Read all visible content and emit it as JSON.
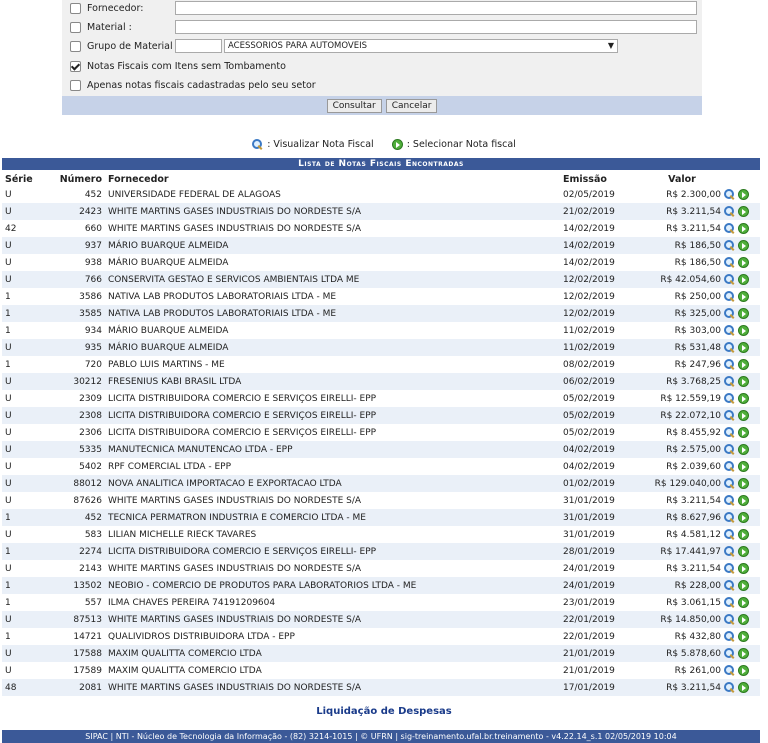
{
  "filters": {
    "fornecedor_label": "Fornecedor:",
    "material_label": "Material :",
    "grupo_label": "Grupo de Material :",
    "grupo_code": "",
    "grupo_value": "ACESSORIOS PARA AUTOMOVEIS",
    "tombamento_label": "Notas Fiscais com Itens sem Tombamento",
    "setor_label": "Apenas notas fiscais cadastradas pelo seu setor",
    "consultar": "Consultar",
    "cancelar": "Cancelar"
  },
  "legend": {
    "view": ": Visualizar Nota Fiscal",
    "select": ": Selecionar Nota fiscal"
  },
  "table": {
    "caption": "Lista de Notas Fiscais Encontradas",
    "headers": [
      "Série",
      "Número",
      "Fornecedor",
      "Emissão",
      "Valor"
    ],
    "rows": [
      [
        "U",
        "452",
        "UNIVERSIDADE FEDERAL DE ALAGOAS",
        "02/05/2019",
        "R$ 2.300,00"
      ],
      [
        "U",
        "2423",
        "WHITE MARTINS GASES INDUSTRIAIS DO NORDESTE S/A",
        "21/02/2019",
        "R$ 3.211,54"
      ],
      [
        "42",
        "660",
        "WHITE MARTINS GASES INDUSTRIAIS DO NORDESTE S/A",
        "14/02/2019",
        "R$ 3.211,54"
      ],
      [
        "U",
        "937",
        "MÁRIO BUARQUE ALMEIDA",
        "14/02/2019",
        "R$ 186,50"
      ],
      [
        "U",
        "938",
        "MÁRIO BUARQUE ALMEIDA",
        "14/02/2019",
        "R$ 186,50"
      ],
      [
        "U",
        "766",
        "CONSERVITA GESTAO E SERVICOS AMBIENTAIS LTDA ME",
        "12/02/2019",
        "R$ 42.054,60"
      ],
      [
        "1",
        "3586",
        "NATIVA LAB PRODUTOS LABORATORIAIS LTDA - ME",
        "12/02/2019",
        "R$ 250,00"
      ],
      [
        "1",
        "3585",
        "NATIVA LAB PRODUTOS LABORATORIAIS LTDA - ME",
        "12/02/2019",
        "R$ 325,00"
      ],
      [
        "1",
        "934",
        "MÁRIO BUARQUE ALMEIDA",
        "11/02/2019",
        "R$ 303,00"
      ],
      [
        "U",
        "935",
        "MÁRIO BUARQUE ALMEIDA",
        "11/02/2019",
        "R$ 531,48"
      ],
      [
        "1",
        "720",
        "PABLO LUIS MARTINS - ME",
        "08/02/2019",
        "R$ 247,96"
      ],
      [
        "U",
        "30212",
        "FRESENIUS KABI BRASIL LTDA",
        "06/02/2019",
        "R$ 3.768,25"
      ],
      [
        "U",
        "2309",
        "LICITA DISTRIBUIDORA COMERCIO E SERVIÇOS EIRELLI- EPP",
        "05/02/2019",
        "R$ 12.559,19"
      ],
      [
        "U",
        "2308",
        "LICITA DISTRIBUIDORA COMERCIO E SERVIÇOS EIRELLI- EPP",
        "05/02/2019",
        "R$ 22.072,10"
      ],
      [
        "U",
        "2306",
        "LICITA DISTRIBUIDORA COMERCIO E SERVIÇOS EIRELLI- EPP",
        "05/02/2019",
        "R$ 8.455,92"
      ],
      [
        "U",
        "5335",
        "MANUTECNICA MANUTENCAO LTDA - EPP",
        "04/02/2019",
        "R$ 2.575,00"
      ],
      [
        "U",
        "5402",
        "RPF COMERCIAL LTDA - EPP",
        "04/02/2019",
        "R$ 2.039,60"
      ],
      [
        "U",
        "88012",
        "NOVA ANALITICA IMPORTACAO E EXPORTACAO LTDA",
        "01/02/2019",
        "R$ 129.040,00"
      ],
      [
        "U",
        "87626",
        "WHITE MARTINS GASES INDUSTRIAIS DO NORDESTE S/A",
        "31/01/2019",
        "R$ 3.211,54"
      ],
      [
        "1",
        "452",
        "TECNICA PERMATRON INDUSTRIA E COMERCIO LTDA - ME",
        "31/01/2019",
        "R$ 8.627,96"
      ],
      [
        "U",
        "583",
        "LILIAN MICHELLE RIECK TAVARES",
        "31/01/2019",
        "R$ 4.581,12"
      ],
      [
        "1",
        "2274",
        "LICITA DISTRIBUIDORA COMERCIO E SERVIÇOS EIRELLI- EPP",
        "28/01/2019",
        "R$ 17.441,97"
      ],
      [
        "U",
        "2143",
        "WHITE MARTINS GASES INDUSTRIAIS DO NORDESTE S/A",
        "24/01/2019",
        "R$ 3.211,54"
      ],
      [
        "1",
        "13502",
        "NEOBIO - COMERCIO DE PRODUTOS PARA LABORATORIOS LTDA - ME",
        "24/01/2019",
        "R$ 228,00"
      ],
      [
        "1",
        "557",
        "ILMA CHAVES PEREIRA 74191209604",
        "23/01/2019",
        "R$ 3.061,15"
      ],
      [
        "U",
        "87513",
        "WHITE MARTINS GASES INDUSTRIAIS DO NORDESTE S/A",
        "22/01/2019",
        "R$ 14.850,00"
      ],
      [
        "1",
        "14721",
        "QUALIVIDROS DISTRIBUIDORA LTDA - EPP",
        "22/01/2019",
        "R$ 432,80"
      ],
      [
        "U",
        "17588",
        "MAXIM QUALITTA COMERCIO LTDA",
        "21/01/2019",
        "R$ 5.878,60"
      ],
      [
        "U",
        "17589",
        "MAXIM QUALITTA COMERCIO LTDA",
        "21/01/2019",
        "R$ 261,00"
      ],
      [
        "48",
        "2081",
        "WHITE MARTINS GASES INDUSTRIAIS DO NORDESTE S/A",
        "17/01/2019",
        "R$ 3.211,54"
      ]
    ]
  },
  "footlink": "Liquidação de Despesas",
  "footer": "SIPAC | NTI - Núcleo de Tecnologia da Informação - (82) 3214-1015 | © UFRN | sig-treinamento.ufal.br.treinamento - v4.22.14_s.1 02/05/2019 10:04"
}
